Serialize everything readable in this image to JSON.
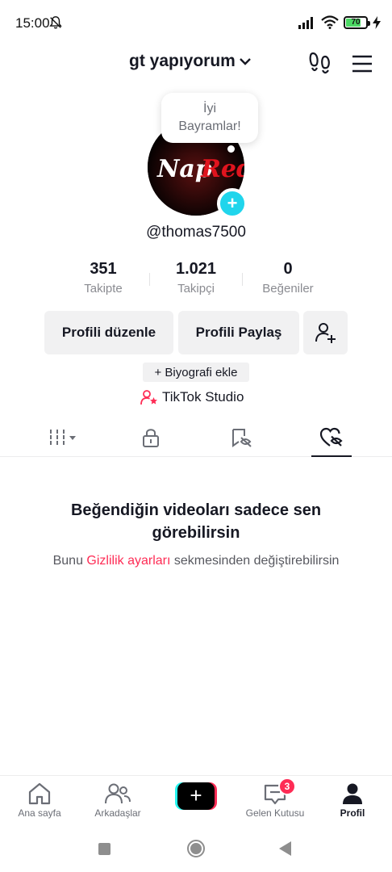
{
  "status_bar": {
    "time": "15:00",
    "battery": "70",
    "battery_level": 0.7,
    "icons": [
      "bell-off-icon",
      "signal-icon",
      "wifi-icon",
      "battery-icon",
      "charging-icon"
    ]
  },
  "header": {
    "account_name": "gt yapıyorum",
    "icons": [
      "chevron-down-icon",
      "footprint-icon",
      "menu-icon"
    ]
  },
  "profile": {
    "note_line1": "İyi",
    "note_line2": "Bayramlar!",
    "avatar_text": "NapRed",
    "username": "@thomas7500"
  },
  "stats": [
    {
      "value": "351",
      "label": "Takipte"
    },
    {
      "value": "1.021",
      "label": "Takipçi"
    },
    {
      "value": "0",
      "label": "Beğeniler"
    }
  ],
  "actions": {
    "edit_profile": "Profili düzenle",
    "share_profile": "Profili Paylaş",
    "add_bio": "+ Biyografi ekle",
    "studio": "TikTok Studio"
  },
  "tabs": [
    "videos-grid-icon",
    "private-lock-icon",
    "reposts-hidden-icon",
    "liked-hidden-icon"
  ],
  "empty_state": {
    "title": "Beğendiğin videoları sadece sen görebilirsin",
    "desc_prefix": "Bunu ",
    "desc_link": "Gizlilik ayarları",
    "desc_suffix": " sekmesinden değiştirebilirsin"
  },
  "bottom_nav": {
    "home": "Ana sayfa",
    "friends": "Arkadaşlar",
    "create": "+",
    "inbox": "Gelen Kutusu",
    "inbox_badge": "3",
    "profile": "Profil"
  },
  "colors": {
    "accent": "#fe2c55",
    "cyan": "#20d5ec",
    "text": "#161823",
    "muted": "#8a8b91"
  }
}
